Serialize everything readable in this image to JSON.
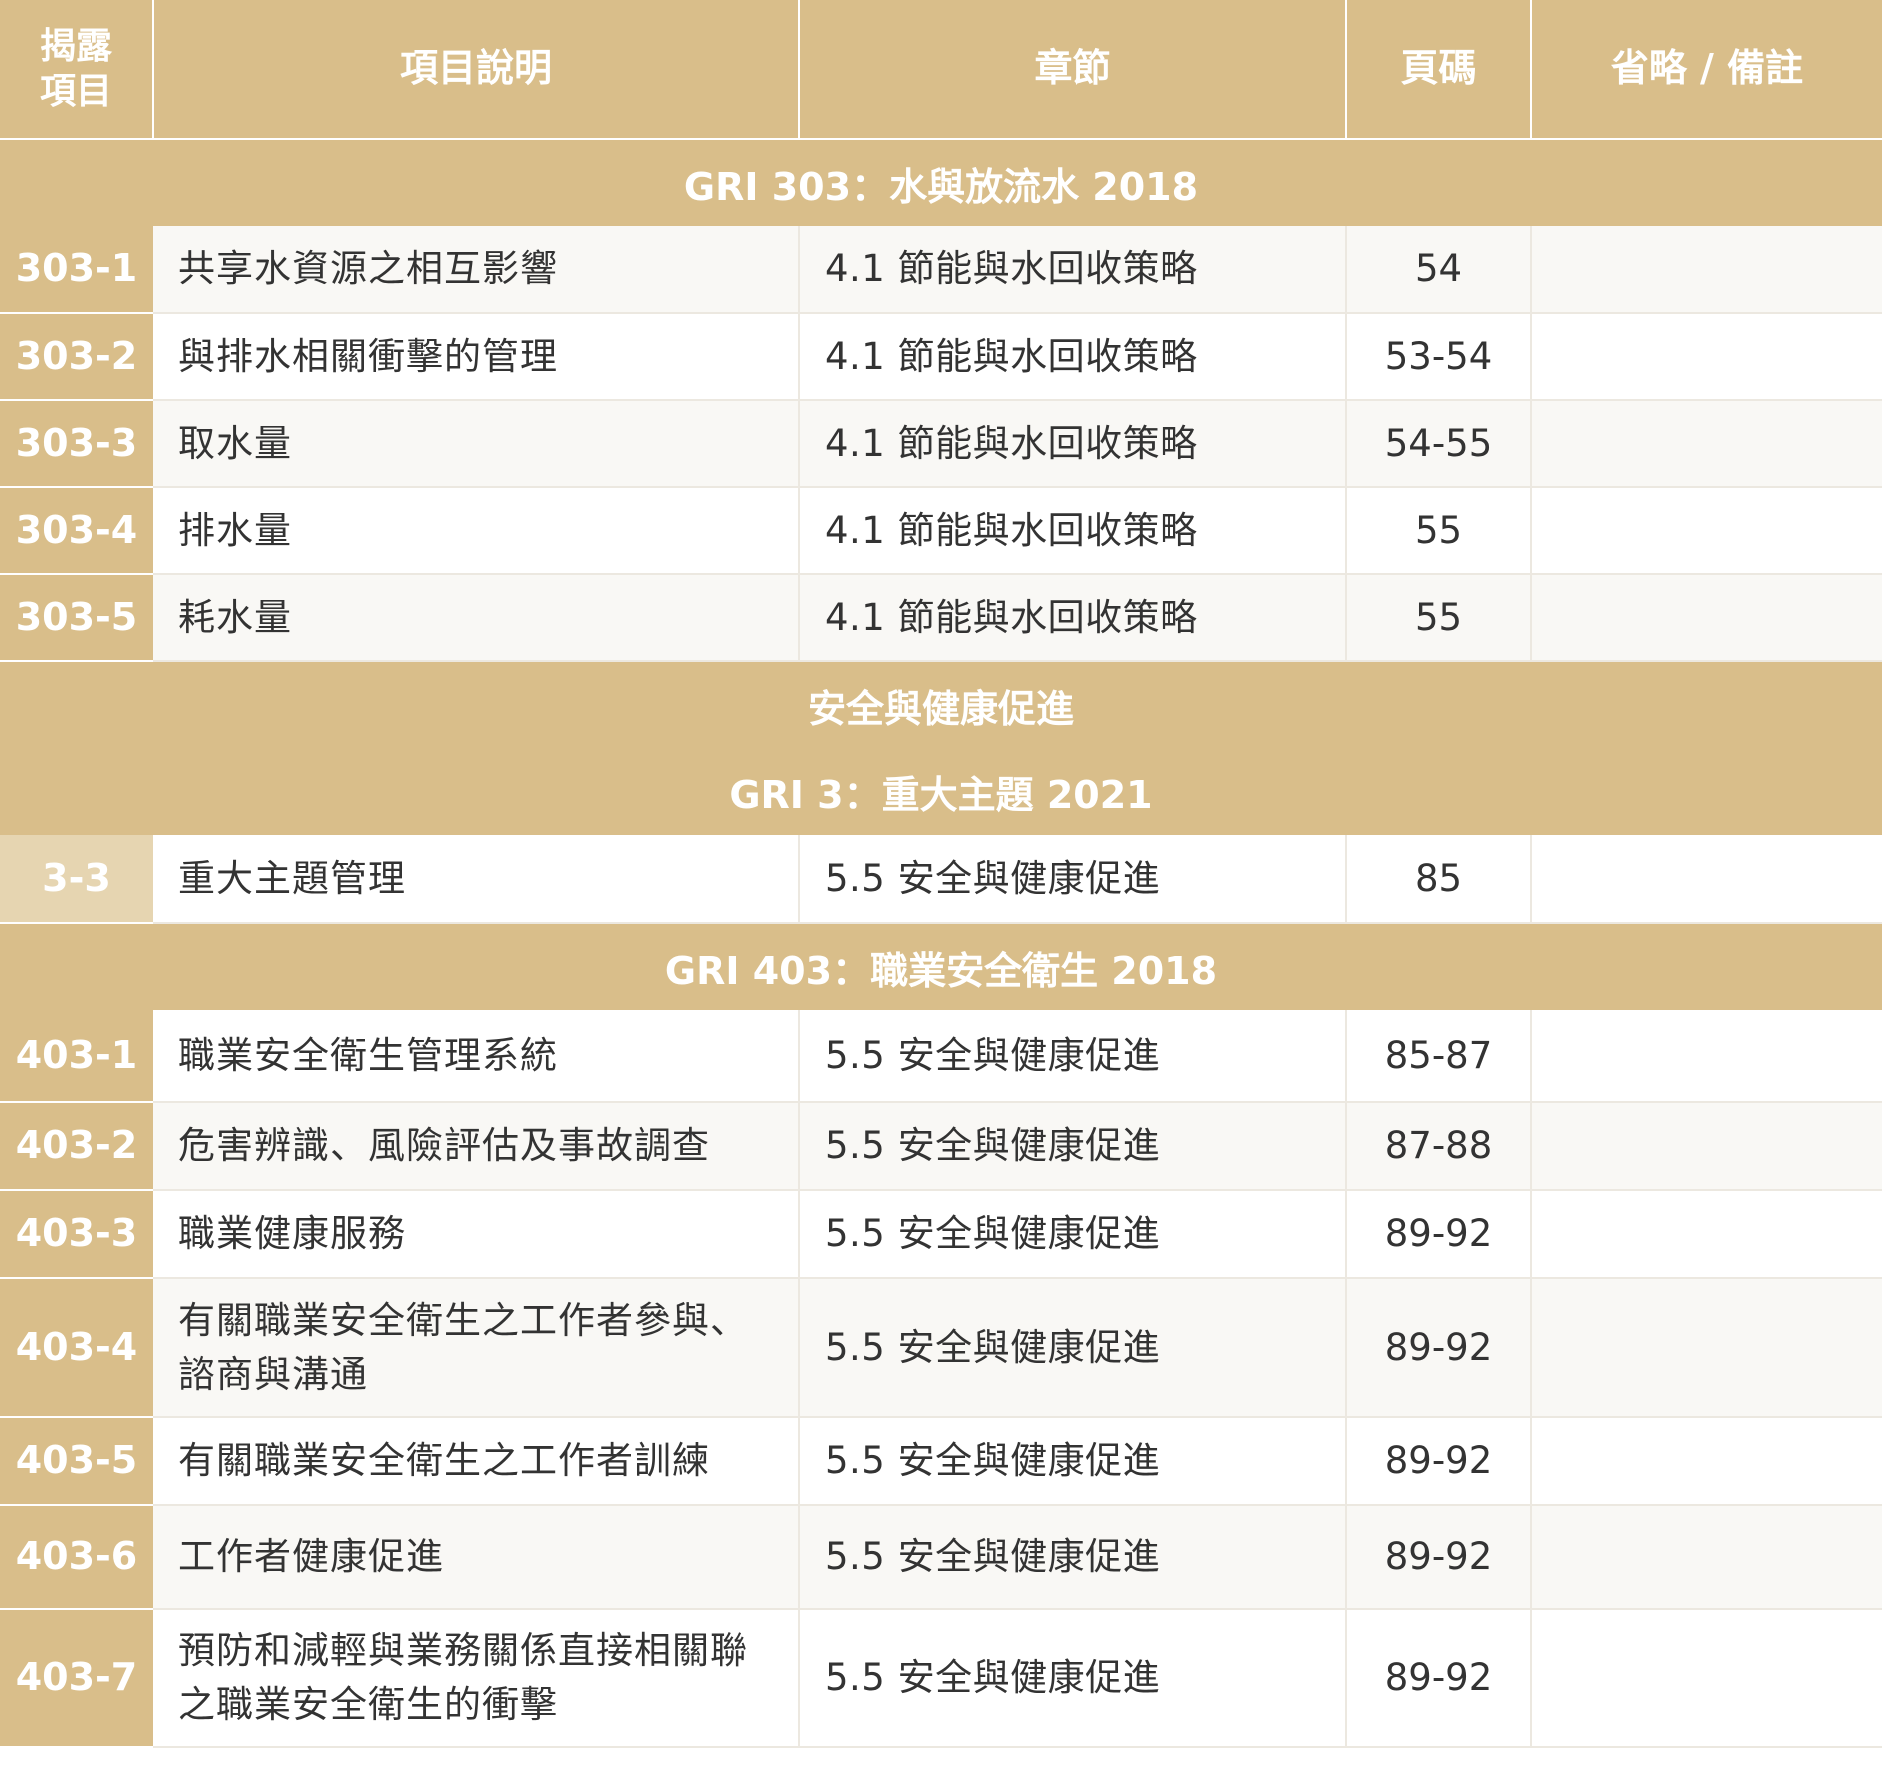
{
  "header": {
    "col1": "揭露\n項目",
    "col2": "項目說明",
    "col3": "章節",
    "col4": "頁碼",
    "col5": "省略 / 備註"
  },
  "sections": [
    {
      "title": "GRI 303：水與放流水 2018"
    },
    {
      "title": "安全與健康促進"
    },
    {
      "title": "GRI 3：重大主題 2021"
    },
    {
      "title": "GRI 403：職業安全衛生 2018"
    }
  ],
  "rows": [
    {
      "code": "303-1",
      "desc": "共享水資源之相互影響",
      "chapter": "4.1 節能與水回收策略",
      "page": "54",
      "note": ""
    },
    {
      "code": "303-2",
      "desc": "與排水相關衝擊的管理",
      "chapter": "4.1 節能與水回收策略",
      "page": "53-54",
      "note": ""
    },
    {
      "code": "303-3",
      "desc": "取水量",
      "chapter": "4.1 節能與水回收策略",
      "page": "54-55",
      "note": ""
    },
    {
      "code": "303-4",
      "desc": "排水量",
      "chapter": "4.1 節能與水回收策略",
      "page": "55",
      "note": ""
    },
    {
      "code": "303-5",
      "desc": "耗水量",
      "chapter": "4.1 節能與水回收策略",
      "page": "55",
      "note": ""
    },
    {
      "code": "3-3",
      "desc": "重大主題管理",
      "chapter": "5.5 安全與健康促進",
      "page": "85",
      "note": ""
    },
    {
      "code": "403-1",
      "desc": "職業安全衛生管理系統",
      "chapter": "5.5 安全與健康促進",
      "page": "85-87",
      "note": ""
    },
    {
      "code": "403-2",
      "desc": "危害辨識、風險評估及事故調查",
      "chapter": "5.5 安全與健康促進",
      "page": "87-88",
      "note": ""
    },
    {
      "code": "403-3",
      "desc": "職業健康服務",
      "chapter": "5.5 安全與健康促進",
      "page": "89-92",
      "note": ""
    },
    {
      "code": "403-4",
      "desc": "有關職業安全衛生之工作者參與、諮商與溝通",
      "chapter": "5.5 安全與健康促進",
      "page": "89-92",
      "note": ""
    },
    {
      "code": "403-5",
      "desc": "有關職業安全衛生之工作者訓練",
      "chapter": "5.5 安全與健康促進",
      "page": "89-92",
      "note": ""
    },
    {
      "code": "403-6",
      "desc": "工作者健康促進",
      "chapter": "5.5 安全與健康促進",
      "page": "89-92",
      "note": ""
    },
    {
      "code": "403-7",
      "desc": "預防和減輕與業務關係直接相關聯之職業安全衛生的衝擊",
      "chapter": "5.5 安全與健康促進",
      "page": "89-92",
      "note": ""
    }
  ],
  "colors": {
    "header_gold": "#d9be8a",
    "code_light_gold": "#e6d5b1",
    "row_alt": "#f9f8f5",
    "text": "#333333"
  }
}
